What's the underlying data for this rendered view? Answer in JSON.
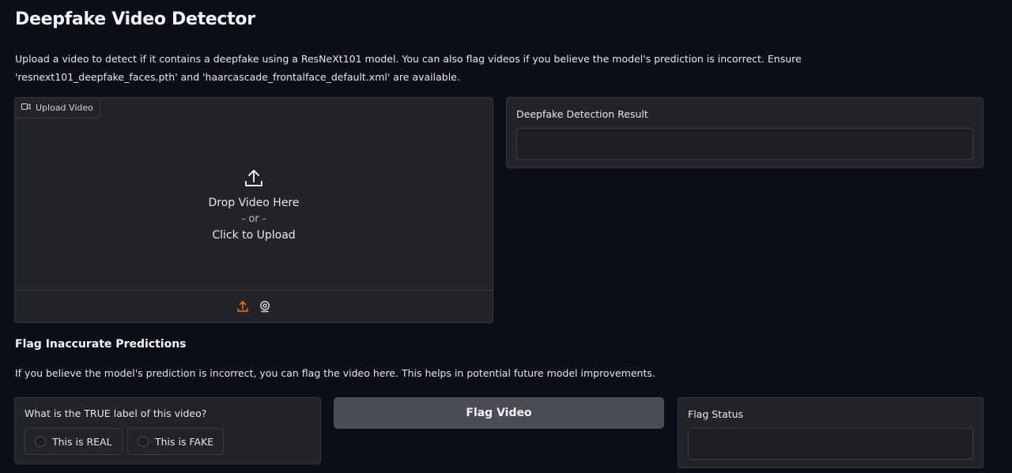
{
  "header": {
    "title": "Deepfake Video Detector",
    "description": "Upload a video to detect if it contains a deepfake using a ResNeXt101 model. You can also flag videos if you believe the model's prediction is incorrect. Ensure 'resnext101_deepfake_faces.pth' and 'haarcascade_frontalface_default.xml' are available."
  },
  "upload": {
    "tag_label": "Upload Video",
    "tag_icon": "video-camera-icon",
    "drop_line1": "Drop Video Here",
    "drop_or": "- or -",
    "drop_line2": "Click to Upload",
    "footer_icons": [
      "upload-icon",
      "webcam-icon"
    ],
    "accent_color": "#f97316"
  },
  "result": {
    "label": "Deepfake Detection Result",
    "value": ""
  },
  "flag_section": {
    "heading": "Flag Inaccurate Predictions",
    "description": "If you believe the model's prediction is incorrect, you can flag the video here. This helps in potential future model improvements.",
    "true_label_question": "What is the TRUE label of this video?",
    "options": [
      {
        "label": "This is REAL",
        "selected": false
      },
      {
        "label": "This is FAKE",
        "selected": false
      }
    ],
    "button_label": "Flag Video",
    "status_label": "Flag Status",
    "status_value": ""
  }
}
